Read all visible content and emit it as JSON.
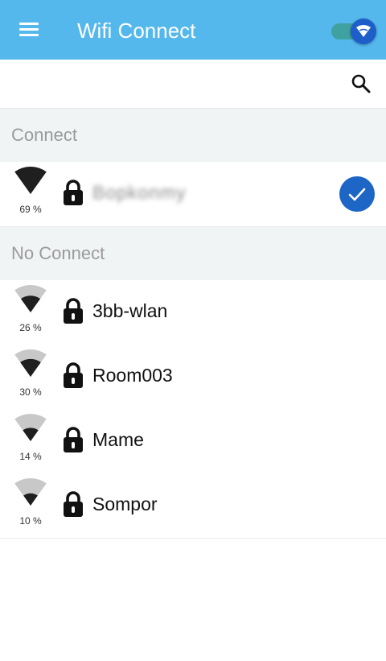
{
  "app_bar": {
    "title": "Wifi Connect",
    "color": "#54b8ec",
    "menu_icon": "hamburger-menu-icon",
    "toggle_state": "on"
  },
  "search": {
    "icon": "search-icon"
  },
  "sections": {
    "connect": {
      "header": "Connect",
      "items": [
        {
          "ssid": "Bopkonmy",
          "percent": "69 %",
          "signal": 0.69,
          "secured": true,
          "connected": true
        }
      ]
    },
    "no_connect": {
      "header": "No Connect",
      "items": [
        {
          "ssid": "3bb-wlan",
          "percent": "26 %",
          "signal": 0.26,
          "secured": true
        },
        {
          "ssid": "Room003",
          "percent": "30 %",
          "signal": 0.3,
          "secured": true
        },
        {
          "ssid": "Mame",
          "percent": "14 %",
          "signal": 0.14,
          "secured": true
        },
        {
          "ssid": "Sompor",
          "percent": "10 %",
          "signal": 0.1,
          "secured": true
        }
      ]
    }
  }
}
